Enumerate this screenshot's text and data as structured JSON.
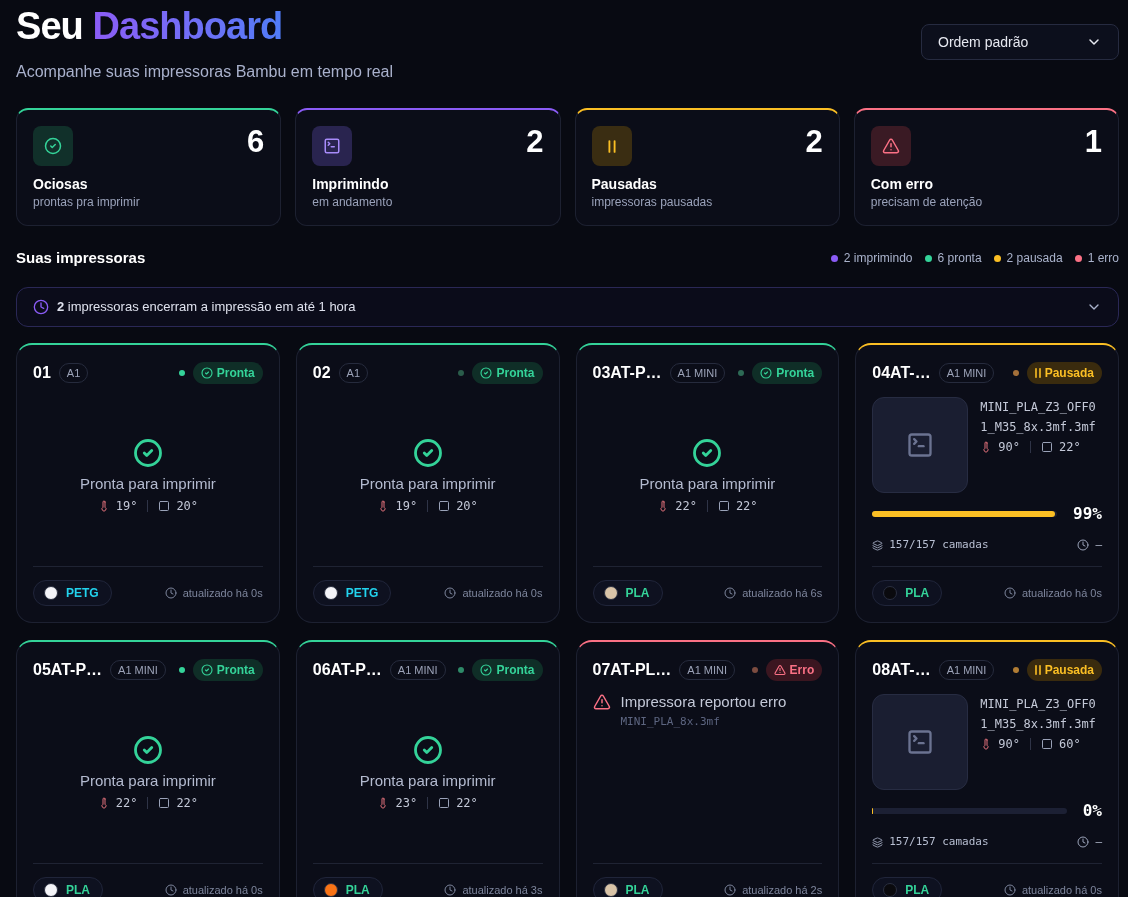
{
  "header": {
    "title": "Seu",
    "title_highlight": "Dashboard",
    "subtitle": "Acompanhe suas impressoras Bambu em tempo real",
    "sort_select": {
      "value": "Ordem padrão"
    }
  },
  "stats": [
    {
      "kind": "idle",
      "count": "6",
      "label": "Ociosas",
      "sublabel": "prontas pra imprimir"
    },
    {
      "kind": "printing",
      "count": "2",
      "label": "Imprimindo",
      "sublabel": "em andamento"
    },
    {
      "kind": "paused",
      "count": "2",
      "label": "Pausadas",
      "sublabel": "impressoras pausadas"
    },
    {
      "kind": "error",
      "count": "1",
      "label": "Com erro",
      "sublabel": "precisam de atenção"
    }
  ],
  "printers_section": {
    "title": "Suas impressoras",
    "legend": [
      {
        "text": "2 imprimindo",
        "color": "#8b5cf6"
      },
      {
        "text": "6 pronta",
        "color": "#34d399"
      },
      {
        "text": "2 pausada",
        "color": "#fbbf24"
      },
      {
        "text": "1 erro",
        "color": "#fb7185"
      }
    ]
  },
  "banner": {
    "text": "**2** impressoras encerram a impressão em até 1 hora",
    "expanded": false
  },
  "printers": [
    {
      "name": "01",
      "model": "A1",
      "kind": "ready",
      "status_label": "Pronta",
      "dot": {
        "color": "#34d399"
      },
      "message": "Pronta para imprimir",
      "nozzle_temp": "19°",
      "bed_temp": "20°",
      "filament": {
        "kind": "petg",
        "type": "PETG",
        "color": "#f4f4f8"
      },
      "updated": "atualizado há 0s"
    },
    {
      "name": "02",
      "model": "A1",
      "kind": "ready",
      "status_label": "Pronta",
      "dot": {
        "color": "#2a5c4a"
      },
      "message": "Pronta para imprimir",
      "nozzle_temp": "19°",
      "bed_temp": "20°",
      "filament": {
        "kind": "petg",
        "type": "PETG",
        "color": "#f4f4f8"
      },
      "updated": "atualizado há 0s"
    },
    {
      "name": "03AT-P…",
      "model": "A1 MINI",
      "kind": "ready",
      "status_label": "Pronta",
      "dot": {
        "color": "#2d6a55"
      },
      "message": "Pronta para imprimir",
      "nozzle_temp": "22°",
      "bed_temp": "22°",
      "filament": {
        "kind": "pla",
        "type": "PLA",
        "color": "#d9c4a8"
      },
      "updated": "atualizado há 6s"
    },
    {
      "name": "04AT-…",
      "model": "A1 MINI",
      "kind": "paused",
      "status_label": "Pausada",
      "dot": {
        "color": "#a4703a"
      },
      "file": "MINI_PLA_Z3_OFF01_M35_8x.3mf.3mf",
      "nozzle_temp": "90°",
      "bed_temp": "22°",
      "level": 0.99,
      "percent": "99%",
      "layers": "157/157 camadas",
      "eta": "–",
      "filament": {
        "kind": "pla",
        "type": "PLA",
        "color": "#0a0a0e"
      },
      "updated": "atualizado há 0s"
    },
    {
      "name": "05AT-P…",
      "model": "A1 MINI",
      "kind": "ready",
      "status_label": "Pronta",
      "dot": {
        "color": "#34d399"
      },
      "message": "Pronta para imprimir",
      "nozzle_temp": "22°",
      "bed_temp": "22°",
      "filament": {
        "kind": "pla",
        "type": "PLA",
        "color": "#f4f4f8"
      },
      "updated": "atualizado há 0s"
    },
    {
      "name": "06AT-P…",
      "model": "A1 MINI",
      "kind": "ready",
      "status_label": "Pronta",
      "dot": {
        "color": "#2e8a68"
      },
      "message": "Pronta para imprimir",
      "nozzle_temp": "23°",
      "bed_temp": "22°",
      "filament": {
        "kind": "pla",
        "type": "PLA",
        "color": "#f97316"
      },
      "updated": "atualizado há 3s"
    },
    {
      "name": "07AT-PL…",
      "model": "A1 MINI",
      "kind": "error",
      "status_label": "Erro",
      "dot": {
        "color": "#7c4c40"
      },
      "message": "Impressora reportou erro",
      "file": "MINI_PLA_8x.3mf",
      "filament": {
        "kind": "pla",
        "type": "PLA",
        "color": "#d9c4a8"
      },
      "updated": "atualizado há 2s"
    },
    {
      "name": "08AT-…",
      "model": "A1 MINI",
      "kind": "paused",
      "status_label": "Pausada",
      "dot": {
        "color": "#b07c34"
      },
      "file": "MINI_PLA_Z3_OFF01_M35_8x.3mf.3mf",
      "nozzle_temp": "90°",
      "bed_temp": "60°",
      "level": 0,
      "percent": "0%",
      "layers": "157/157 camadas",
      "eta": "–",
      "filament": {
        "kind": "pla",
        "type": "PLA",
        "color": "#0a0a0e"
      },
      "updated": "atualizado há 0s"
    }
  ]
}
